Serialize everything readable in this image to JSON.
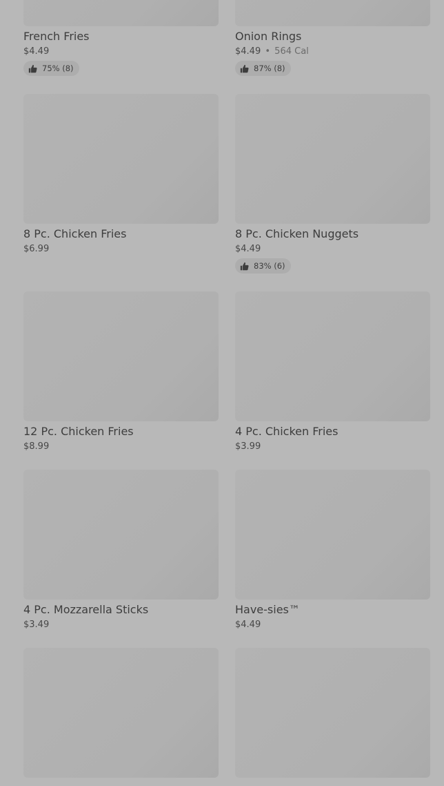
{
  "menu": {
    "items": [
      {
        "name": "French Fries",
        "price": "$4.49",
        "calories": "",
        "rating": "75% (8)"
      },
      {
        "name": "Onion Rings",
        "price": "$4.49",
        "calories": "564 Cal",
        "rating": "87% (8)"
      },
      {
        "name": "8 Pc. Chicken Fries",
        "price": "$6.99",
        "calories": "",
        "rating": ""
      },
      {
        "name": "8 Pc. Chicken Nuggets",
        "price": "$4.49",
        "calories": "",
        "rating": "83% (6)"
      },
      {
        "name": "12 Pc. Chicken Fries",
        "price": "$8.99",
        "calories": "",
        "rating": ""
      },
      {
        "name": "4 Pc. Chicken Fries",
        "price": "$3.99",
        "calories": "",
        "rating": ""
      },
      {
        "name": "4 Pc. Mozzarella Sticks",
        "price": "$3.49",
        "calories": "",
        "rating": ""
      },
      {
        "name": "Have-sies™",
        "price": "$4.49",
        "calories": "",
        "rating": ""
      },
      {
        "name": "",
        "price": "",
        "calories": "",
        "rating": ""
      },
      {
        "name": "",
        "price": "",
        "calories": "",
        "rating": ""
      }
    ],
    "separator": "•",
    "rating_icon": "thumbs-up-icon"
  },
  "colors": {
    "overlay_background": "#b8b8b8",
    "image_placeholder": "#b0b0b0",
    "rating_pill": "#adadad",
    "text": "#3d3d3d"
  }
}
